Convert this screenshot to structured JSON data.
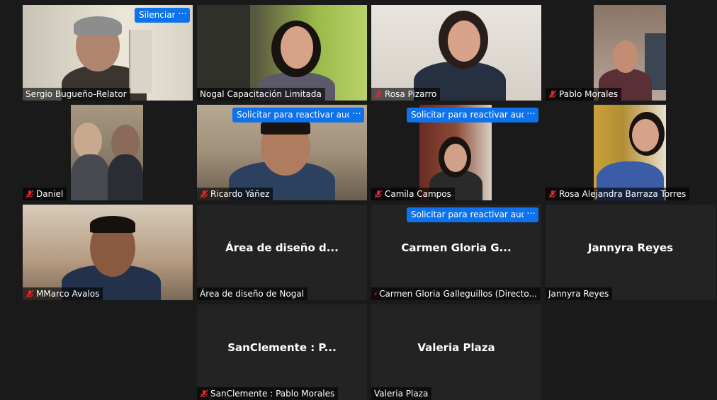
{
  "participants": [
    {
      "name": "Sergio Bugueño-Relator",
      "muted": false,
      "active": false,
      "mute_label": "Silenciar",
      "more_label": "···"
    },
    {
      "name": "Nogal Capacitación Limitada",
      "muted": false,
      "active": true
    },
    {
      "name": "Rosa Pizarro",
      "muted": true
    },
    {
      "name": "Pablo Morales",
      "muted": true
    },
    {
      "name": "Daniel",
      "muted": true
    },
    {
      "name": "Ricardo Yáñez",
      "muted": true,
      "request_label": "Solicitar para reactivar audio",
      "more_label": "···"
    },
    {
      "name": "Camila Campos",
      "muted": true,
      "request_label": "Solicitar para reactivar audio",
      "more_label": "···"
    },
    {
      "name": "Rosa Alejandra Barraza Torres",
      "muted": true
    },
    {
      "name": "MMarco Avalos",
      "muted": true
    },
    {
      "name": "Área de diseño de Nogal",
      "center": "Área de diseño d...",
      "muted": false
    },
    {
      "name": "Carmen Gloria Galleguillos (Directo...",
      "center": "Carmen Gloria G...",
      "muted": true,
      "request_label": "Solicitar para reactivar audio",
      "more_label": "···"
    },
    {
      "name": "Jannyra Reyes",
      "center": "Jannyra Reyes",
      "muted": false
    },
    {
      "name": "SanClemente : Pablo Morales",
      "center": "SanClemente : P...",
      "muted": true
    },
    {
      "name": "Valeria Plaza",
      "center": "Valeria Plaza",
      "muted": false
    }
  ],
  "colors": {
    "accent": "#0e72ed",
    "active_border": "#e3e27a",
    "mic_muted": "#e02828",
    "tile_bg": "#232323"
  }
}
